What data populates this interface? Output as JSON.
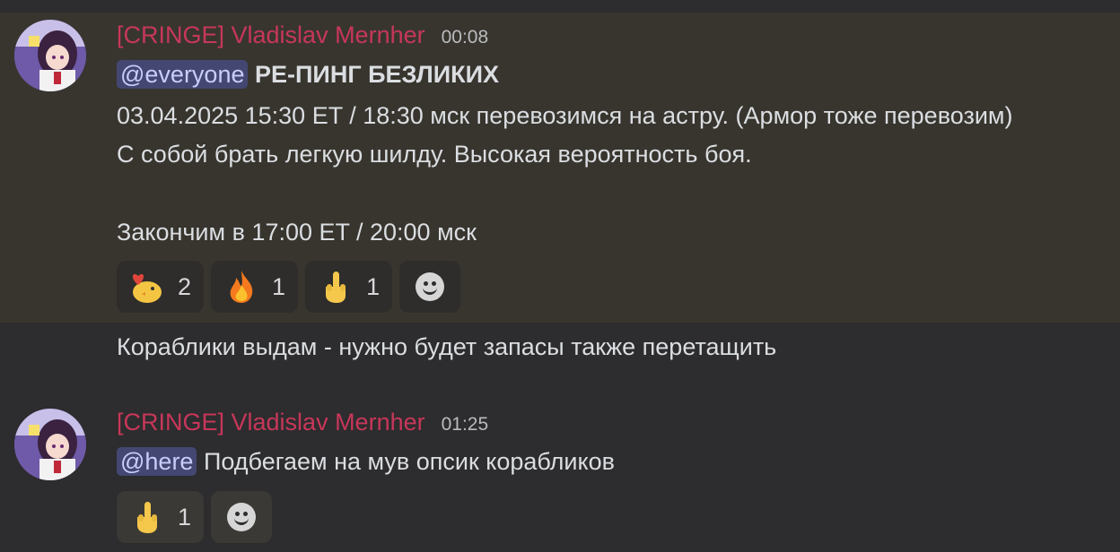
{
  "messages": [
    {
      "author": "[CRINGE] Vladislav Mernher",
      "time": "00:08",
      "mention": "@everyone",
      "title": "РЕ-ПИНГ БЕЗЛИКИХ",
      "lines": [
        "03.04.2025 15:30 ET / 18:30 мск перевозимся на астру. (Армор тоже перевозим)",
        "С собой брать легкую шилду. Высокая вероятность боя.",
        "Закончим в 17:00 ET / 20:00 мск"
      ],
      "reactions": [
        {
          "emoji": "heart-chick-icon",
          "count": "2"
        },
        {
          "emoji": "fire-icon",
          "count": "1"
        },
        {
          "emoji": "middle-finger-icon",
          "count": "1"
        }
      ]
    },
    {
      "text": "Кораблики выдам - нужно будет запасы также перетащить"
    },
    {
      "author": "[CRINGE] Vladislav Mernher",
      "time": "01:25",
      "mention": "@here",
      "text": "Подбегаем на мув опсик корабликов",
      "reactions": [
        {
          "emoji": "middle-finger-icon",
          "count": "1"
        }
      ]
    }
  ],
  "colors": {
    "author": "#c7375a",
    "mention_bg": "#434772",
    "mention_fg": "#c9cdfb"
  }
}
